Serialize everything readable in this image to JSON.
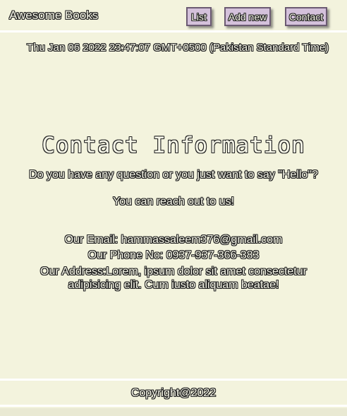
{
  "header": {
    "brand": "Awesome Books",
    "nav": [
      {
        "label": "List"
      },
      {
        "label": "Add new"
      },
      {
        "label": "Contact"
      }
    ]
  },
  "date_text": "Thu Jan 06 2022 23:47:07 GMT+0500 (Pakistan Standard Time)",
  "contact": {
    "title": "Contact Information",
    "question": "Do you have any question or you just want to say \"Hello\"?",
    "reach": "You can reach out to us!",
    "email": "Our Email: hammassaleem376@gmail.com",
    "phone": "Our Phone No: 0937-937-366-383",
    "address_line1": "Our Address:Lorem, ipsum dolor sit amet consectetur",
    "address_line2": "adipisicing elit. Cum iusto aliquam beatae!"
  },
  "footer": {
    "copyright": "Copyright@2022"
  },
  "colors": {
    "background": "#f3f3dd",
    "button": "#d4c1db",
    "text_fill": "#f6f6e8",
    "text_outline": "#222222"
  }
}
